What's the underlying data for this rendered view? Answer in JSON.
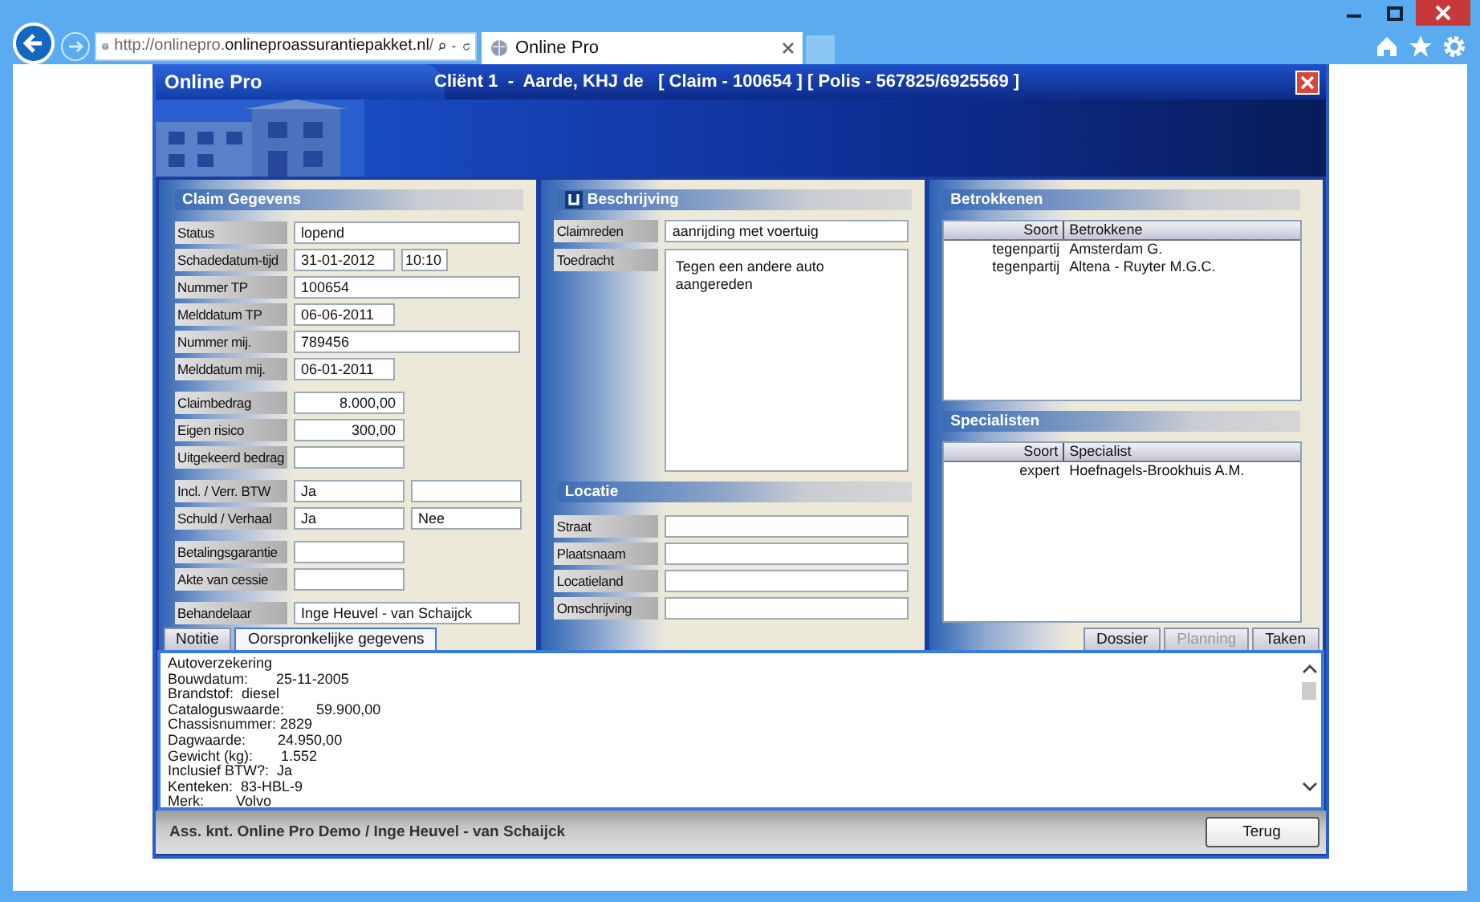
{
  "browser": {
    "url": "http://onlinepro.**onlineproassurantiepakket.nl**/",
    "tab": "Online Pro"
  },
  "app": {
    "name": "Online Pro",
    "title": "Cliënt 1  -  Aarde, KHJ de   [ Claim - 100654 ] [ Polis - 567825/6925569 ]"
  },
  "claim": {
    "heading": "Claim Gegevens",
    "groups": [
      [
        {
          "label": "Status",
          "fields": [
            {
              "kind": "text",
              "value": "lopend"
            }
          ]
        },
        {
          "label": "Schadedatum-tijd",
          "fields": [
            {
              "kind": "date",
              "value": "31-01-2012"
            },
            {
              "kind": "time",
              "value": "10:10"
            }
          ]
        },
        {
          "label": "Nummer TP",
          "fields": [
            {
              "kind": "text",
              "value": "100654"
            }
          ]
        },
        {
          "label": "Melddatum TP",
          "fields": [
            {
              "kind": "date",
              "value": "06-06-2011"
            }
          ]
        },
        {
          "label": "Nummer mij.",
          "fields": [
            {
              "kind": "text",
              "value": "789456"
            }
          ]
        },
        {
          "label": "Melddatum mij.",
          "fields": [
            {
              "kind": "date",
              "value": "06-01-2011"
            }
          ]
        }
      ],
      [
        {
          "label": "Claimbedrag",
          "fields": [
            {
              "kind": "amount",
              "value": "8.000,00"
            }
          ]
        },
        {
          "label": "Eigen risico",
          "fields": [
            {
              "kind": "amount",
              "value": "300,00"
            }
          ]
        },
        {
          "label": "Uitgekeerd bedrag",
          "fields": [
            {
              "kind": "amount"
            }
          ]
        }
      ],
      [
        {
          "label": "Incl. / Verr. BTW",
          "fields": [
            {
              "kind": "half",
              "value": "Ja"
            },
            {
              "kind": "half"
            }
          ]
        },
        {
          "label": "Schuld / Verhaal",
          "fields": [
            {
              "kind": "half",
              "value": "Ja"
            },
            {
              "kind": "half",
              "value": "Nee"
            }
          ]
        }
      ],
      [
        {
          "label": "Betalingsgarantie",
          "fields": [
            {
              "kind": "amount"
            }
          ]
        },
        {
          "label": "Akte van cessie",
          "fields": [
            {
              "kind": "amount"
            }
          ]
        }
      ],
      [
        {
          "label": "Behandelaar",
          "fields": [
            {
              "kind": "text",
              "value": "Inge Heuvel - van Schaijck"
            }
          ]
        }
      ]
    ]
  },
  "description": {
    "heading": "Beschrijving",
    "reason_label": "Claimreden",
    "reason": "aanrijding met voertuig",
    "account_label": "Toedracht",
    "account": "Tegen een andere auto aangereden"
  },
  "location": {
    "heading": "Locatie",
    "fields": [
      {
        "label": "Straat"
      },
      {
        "label": "Plaatsnaam"
      },
      {
        "label": "Locatieland"
      },
      {
        "label": "Omschrijving"
      }
    ]
  },
  "parties": {
    "heading": "Betrokkenen",
    "columns": [
      "Soort",
      "Betrokkene"
    ],
    "rows": [
      [
        "tegenpartij",
        "Amsterdam G."
      ],
      [
        "tegenpartij",
        "Altena - Ruyter M.G.C."
      ]
    ]
  },
  "specialists": {
    "heading": "Specialisten",
    "columns": [
      "Soort",
      "Specialist"
    ],
    "rows": [
      [
        "expert",
        "Hoefnagels-Brookhuis A.M."
      ]
    ]
  },
  "notes_tabs": [
    {
      "label": "Notitie",
      "selected": false
    },
    {
      "label": "Oorspronkelijke gegevens",
      "selected": true
    }
  ],
  "side_tabs": [
    {
      "label": "Dossier",
      "disabled": false
    },
    {
      "label": "Planning",
      "disabled": true
    },
    {
      "label": "Taken",
      "disabled": false
    }
  ],
  "notes": [
    "Autoverzekering",
    "Bouwdatum:       25-11-2005",
    "Brandstof:  diesel",
    "Cataloguswaarde:        59.900,00",
    "Chassisnummer: 2829",
    "Dagwaarde:        24.950,00",
    "Gewicht (kg):       1.552",
    "Inclusief BTW?:  Ja",
    "Kenteken:  83-HBL-9",
    "Merk:        Volvo"
  ],
  "status_bar": {
    "text": "Ass. knt. Online Pro Demo / Inge Heuvel - van Schaijck",
    "button": "Terug"
  }
}
